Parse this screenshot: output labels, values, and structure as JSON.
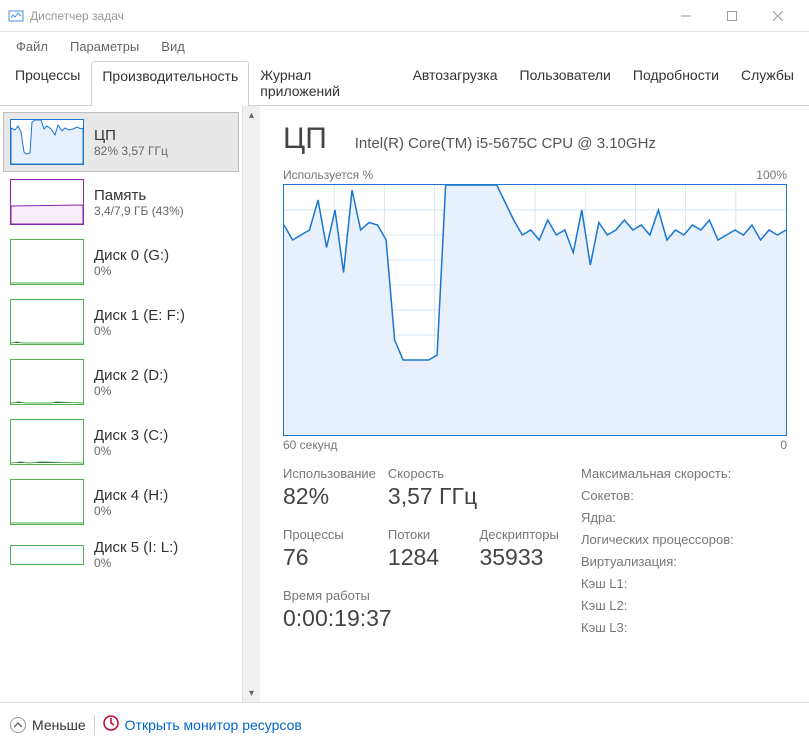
{
  "window": {
    "title": "Диспетчер задач"
  },
  "menu": {
    "file": "Файл",
    "params": "Параметры",
    "view": "Вид"
  },
  "tabs": {
    "t0": "Процессы",
    "t1": "Производительность",
    "t2": "Журнал приложений",
    "t3": "Автозагрузка",
    "t4": "Пользователи",
    "t5": "Подробности",
    "t6": "Службы"
  },
  "sidebar": {
    "items": [
      {
        "title": "ЦП",
        "sub": "82% 3,57 ГГц",
        "type": "cpu"
      },
      {
        "title": "Память",
        "sub": "3,4/7,9 ГБ (43%)",
        "type": "mem"
      },
      {
        "title": "Диск 0 (G:)",
        "sub": "0%",
        "type": "disk"
      },
      {
        "title": "Диск 1 (E: F:)",
        "sub": "0%",
        "type": "disk"
      },
      {
        "title": "Диск 2 (D:)",
        "sub": "0%",
        "type": "disk"
      },
      {
        "title": "Диск 3 (C:)",
        "sub": "0%",
        "type": "disk"
      },
      {
        "title": "Диск 4 (H:)",
        "sub": "0%",
        "type": "disk"
      },
      {
        "title": "Диск 5 (I: L:)",
        "sub": "0%",
        "type": "disk"
      }
    ]
  },
  "main": {
    "title": "ЦП",
    "cpu_name": "Intel(R) Core(TM) i5-5675C CPU @ 3.10GHz",
    "graph_label_left": "Используется %",
    "graph_label_right": "100%",
    "graph_x_left": "60 секунд",
    "graph_x_right": "0",
    "stats": {
      "usage_label": "Использование",
      "usage_value": "82%",
      "speed_label": "Скорость",
      "speed_value": "3,57 ГГц",
      "processes_label": "Процессы",
      "processes_value": "76",
      "threads_label": "Потоки",
      "threads_value": "1284",
      "handles_label": "Дескрипторы",
      "handles_value": "35933",
      "uptime_label": "Время работы",
      "uptime_value": "0:00:19:37"
    },
    "info": {
      "max_speed": "Максимальная скорость:",
      "sockets": "Сокетов:",
      "cores": "Ядра:",
      "logical": "Логических процессоров:",
      "virt": "Виртуализация:",
      "l1": "Кэш L1:",
      "l2": "Кэш L2:",
      "l3": "Кэш L3:"
    }
  },
  "footer": {
    "less": "Меньше",
    "monitor": "Открыть монитор ресурсов"
  },
  "chart_data": {
    "type": "line",
    "title": "Используется %",
    "xlabel": "60 секунд",
    "ylabel": "%",
    "ylim": [
      0,
      100
    ],
    "x_range": [
      60,
      0
    ],
    "series": [
      {
        "name": "CPU",
        "values": [
          84,
          78,
          80,
          82,
          94,
          75,
          90,
          65,
          98,
          82,
          85,
          84,
          78,
          38,
          30,
          30,
          30,
          30,
          32,
          100,
          100,
          100,
          100,
          100,
          100,
          100,
          93,
          86,
          80,
          82,
          78,
          86,
          80,
          82,
          73,
          90,
          68,
          85,
          80,
          82,
          86,
          82,
          84,
          80,
          90,
          78,
          82,
          80,
          84,
          82,
          86,
          78,
          80,
          82,
          80,
          84,
          78,
          82,
          80,
          82
        ]
      }
    ]
  }
}
